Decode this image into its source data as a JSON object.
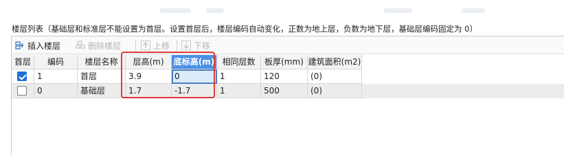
{
  "list_title": "楼层列表（基础层和标准层不能设置为首层。设置首层后，楼层编码自动变化，正数为地上层，负数为地下层，基础层编码固定为 0）",
  "toolbar": {
    "insert_label": "插入楼层",
    "delete_label": "删除楼层",
    "up_label": "上移",
    "down_label": "下移"
  },
  "table": {
    "headers": [
      "首层",
      "编码",
      "楼层名称",
      "层高(m)",
      "底标高(m)",
      "相同层数",
      "板厚(mm)",
      "建筑面积(m2)"
    ],
    "rows": [
      {
        "first_floor": true,
        "code": "1",
        "name": "首层",
        "height": "3.9",
        "bottom_elev": "0",
        "same_count": "1",
        "slab": "120",
        "area": "(0)"
      },
      {
        "first_floor": false,
        "code": "0",
        "name": "基础层",
        "height": "1.7",
        "bottom_elev": "-1.7",
        "same_count": "1",
        "slab": "500",
        "area": "(0)"
      }
    ]
  },
  "colors": {
    "selected_header": "#4a90e2",
    "checkbox_on": "#1e6fd9",
    "highlight_box": "#e23a3a"
  }
}
